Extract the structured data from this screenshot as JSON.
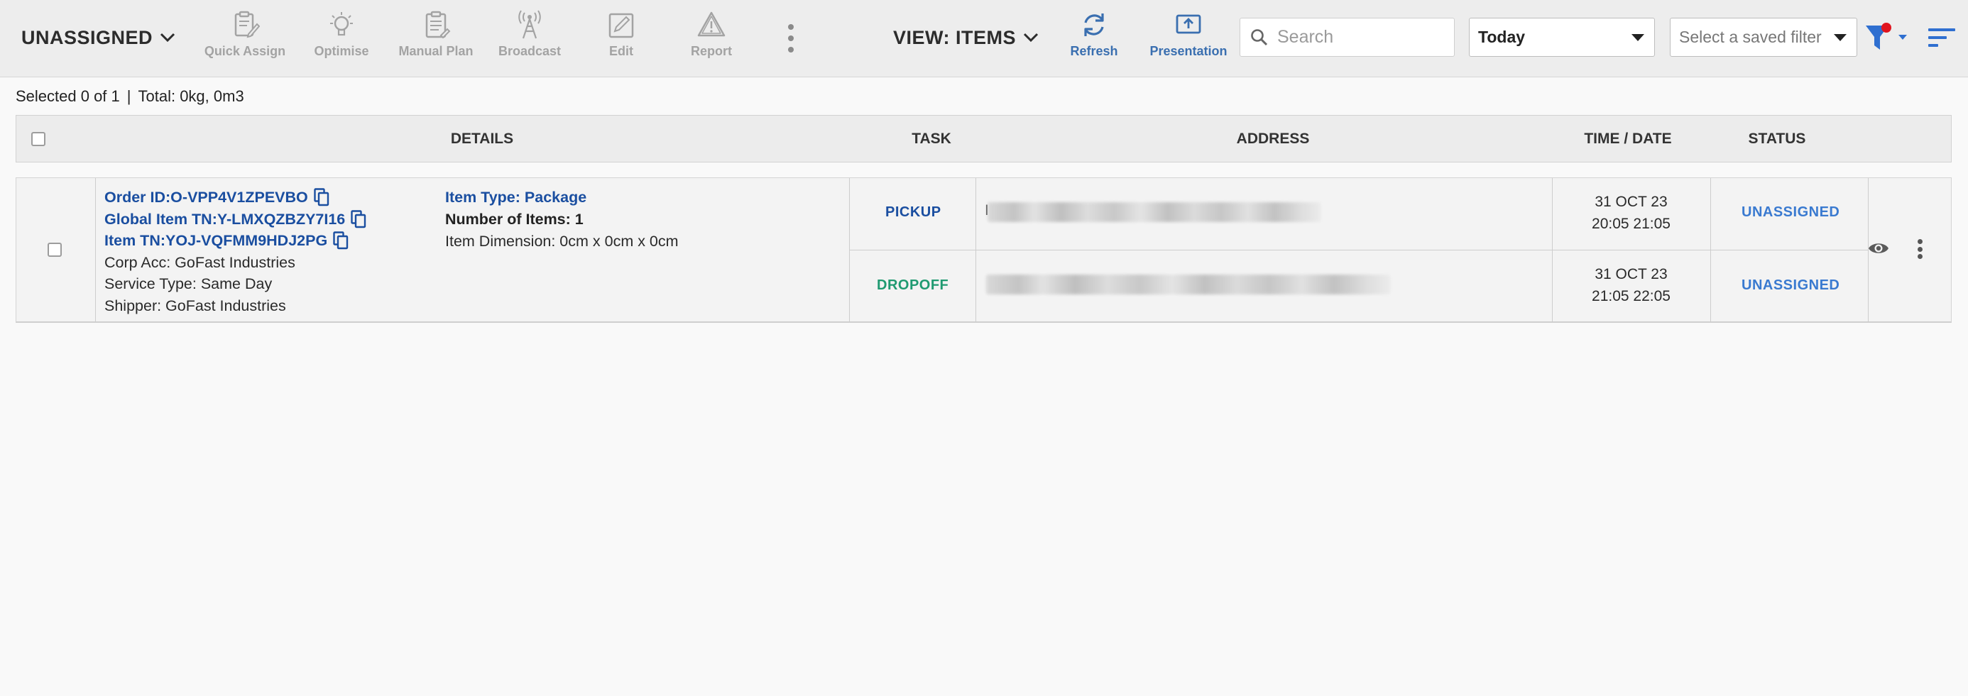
{
  "toolbar": {
    "status_filter": "UNASSIGNED",
    "tools": [
      {
        "label": "Quick Assign",
        "icon": "clipboard-edit-icon"
      },
      {
        "label": "Optimise",
        "icon": "lightbulb-icon"
      },
      {
        "label": "Manual Plan",
        "icon": "clipboard-list-icon"
      },
      {
        "label": "Broadcast",
        "icon": "antenna-icon"
      },
      {
        "label": "Edit",
        "icon": "pencil-box-icon"
      },
      {
        "label": "Report",
        "icon": "warning-triangle-icon"
      }
    ],
    "view_label": "VIEW: ITEMS",
    "refresh_label": "Refresh",
    "presentation_label": "Presentation",
    "search_placeholder": "Search",
    "date_range": "Today",
    "saved_filter_placeholder": "Select a saved filter"
  },
  "summary": {
    "selected": "Selected 0 of 1",
    "separator": "|",
    "total": "Total: 0kg, 0m3"
  },
  "table": {
    "headers": [
      "DETAILS",
      "TASK",
      "ADDRESS",
      "TIME / DATE",
      "STATUS"
    ],
    "rows": [
      {
        "order_id": "Order ID:O-VPP4V1ZPEVBO",
        "global_item_tn": "Global Item TN:Y-LMXQZBZY7I16",
        "item_tn": "Item TN:YOJ-VQFMM9HDJ2PG",
        "corp_acc": "Corp Acc: GoFast Industries",
        "service_type": "Service Type: Same Day",
        "shipper": "Shipper: GoFast Industries",
        "item_type": "Item Type: Package",
        "number_of_items": "Number of Items: 1",
        "item_dimension": "Item Dimension: 0cm x 0cm x 0cm",
        "tasks": [
          {
            "task": "PICKUP",
            "address_visible_prefix": "I",
            "date": "31 OCT 23",
            "time": "20:05 21:05",
            "status": "UNASSIGNED"
          },
          {
            "task": "DROPOFF",
            "address_visible_prefix": "",
            "date": "31 OCT 23",
            "time": "21:05 22:05",
            "status": "UNASSIGNED"
          }
        ]
      }
    ]
  },
  "colors": {
    "link_blue": "#1a4ea0",
    "status_blue": "#3a7ad0",
    "dropoff_green": "#1f9a71",
    "toolbar_bg": "#ededed",
    "filter_active_dot": "#e0141e"
  }
}
